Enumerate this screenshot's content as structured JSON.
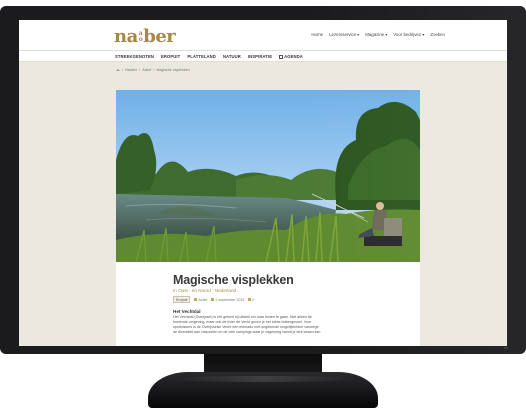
{
  "logo": {
    "left": "na",
    "mid_top": "a",
    "mid_bottom": "o",
    "right": "ber"
  },
  "topnav": [
    "Home",
    "Lezersservice",
    "Magazine",
    "Voor bedrijven",
    "Zoeken"
  ],
  "catnav": [
    "STREEKGENOTEN",
    "EROPUIT",
    "PLATTELAND",
    "NATUUR",
    "INSPIRATIE",
    "AGENDA"
  ],
  "breadcrumb": [
    "Naober",
    "Actief",
    "Magische visplekken"
  ],
  "article": {
    "title": "Magische visplekken",
    "subtitle": "In Oost - en Noord - Nederland",
    "category_badge": "Eropuit",
    "meta_section": "Actief",
    "date": "2 september 2015",
    "comments": "0",
    "section_heading": "Het Vechtdal",
    "paragraph_lines": [
      "Het Vechtdal (Overijssel) is hét gebied bij uitstek om naar buiten te gaan. Niet alleen de",
      "boeiende omgeving, maar ook de rivier de Vecht geven je het echte buitengevoel. Voor",
      "sportvissers is de Overijsselse Vecht een eldorado met ongekende mogelijkheden vanwege",
      "de diversiteit aan vissoorten en de vele campings waar je nagenoeg vanuit je tent vissen kan"
    ]
  },
  "colors": {
    "accent": "#a88a3e",
    "page_bg": "#ebe8df",
    "bezel": "#1b1b1d"
  },
  "icons": {
    "home": "home-icon",
    "calendar": "calendar-icon",
    "folder": "folder-icon",
    "comment": "comment-icon"
  }
}
